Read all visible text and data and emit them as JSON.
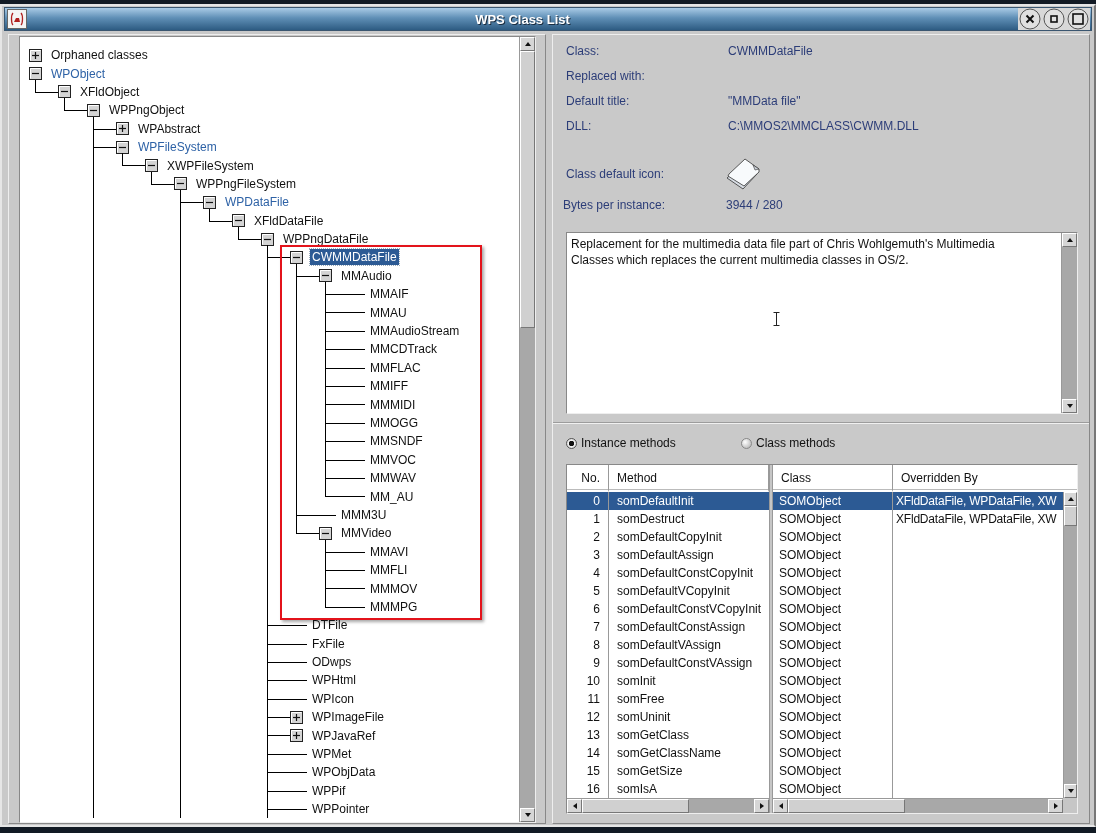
{
  "window": {
    "title": "WPS Class List"
  },
  "class_tree": [
    {
      "label": "Orphaned classes",
      "kind": "branch",
      "expanded": false,
      "replaced": false,
      "selected": false,
      "annotated": false
    },
    {
      "label": "WPObject",
      "kind": "branch",
      "expanded": true,
      "more_below": false,
      "replaced": true,
      "selected": false,
      "annotated": false,
      "children": [
        {
          "label": "XFldObject",
          "kind": "branch",
          "expanded": true,
          "more_below": false,
          "replaced": false,
          "selected": false,
          "annotated": false,
          "children": [
            {
              "label": "WPPngObject",
              "kind": "branch",
              "expanded": true,
              "more_below": true,
              "replaced": false,
              "selected": false,
              "annotated": false,
              "children": [
                {
                  "label": "WPAbstract",
                  "kind": "branch",
                  "expanded": false,
                  "replaced": false,
                  "selected": false,
                  "annotated": false
                },
                {
                  "label": "WPFileSystem",
                  "kind": "branch",
                  "expanded": true,
                  "more_below": false,
                  "replaced": true,
                  "selected": false,
                  "annotated": false,
                  "children": [
                    {
                      "label": "XWPFileSystem",
                      "kind": "branch",
                      "expanded": true,
                      "more_below": false,
                      "replaced": false,
                      "selected": false,
                      "annotated": false,
                      "children": [
                        {
                          "label": "WPPngFileSystem",
                          "kind": "branch",
                          "expanded": true,
                          "more_below": true,
                          "replaced": false,
                          "selected": false,
                          "annotated": false,
                          "children": [
                            {
                              "label": "WPDataFile",
                              "kind": "branch",
                              "expanded": true,
                              "more_below": false,
                              "replaced": true,
                              "selected": false,
                              "annotated": false,
                              "children": [
                                {
                                  "label": "XFldDataFile",
                                  "kind": "branch",
                                  "expanded": true,
                                  "more_below": false,
                                  "replaced": false,
                                  "selected": false,
                                  "annotated": false,
                                  "children": [
                                    {
                                      "label": "WPPngDataFile",
                                      "kind": "branch",
                                      "expanded": true,
                                      "more_below": true,
                                      "replaced": false,
                                      "selected": false,
                                      "annotated": false,
                                      "children": [
                                        {
                                          "label": "CWMMDataFile",
                                          "kind": "branch",
                                          "expanded": true,
                                          "more_below": false,
                                          "replaced": false,
                                          "selected": true,
                                          "annotated": true,
                                          "children": [
                                            {
                                              "label": "MMAudio",
                                              "kind": "branch",
                                              "expanded": true,
                                              "more_below": false,
                                              "replaced": false,
                                              "selected": false,
                                              "annotated": false,
                                              "children": [
                                                {
                                                  "label": "MMAIF",
                                                  "kind": "leaf",
                                                  "replaced": false,
                                                  "selected": false,
                                                  "annotated": false
                                                },
                                                {
                                                  "label": "MMAU",
                                                  "kind": "leaf",
                                                  "replaced": false,
                                                  "selected": false,
                                                  "annotated": false
                                                },
                                                {
                                                  "label": "MMAudioStream",
                                                  "kind": "leaf",
                                                  "replaced": false,
                                                  "selected": false,
                                                  "annotated": false
                                                },
                                                {
                                                  "label": "MMCDTrack",
                                                  "kind": "leaf",
                                                  "replaced": false,
                                                  "selected": false,
                                                  "annotated": false
                                                },
                                                {
                                                  "label": "MMFLAC",
                                                  "kind": "leaf",
                                                  "replaced": false,
                                                  "selected": false,
                                                  "annotated": false
                                                },
                                                {
                                                  "label": "MMIFF",
                                                  "kind": "leaf",
                                                  "replaced": false,
                                                  "selected": false,
                                                  "annotated": false
                                                },
                                                {
                                                  "label": "MMMIDI",
                                                  "kind": "leaf",
                                                  "replaced": false,
                                                  "selected": false,
                                                  "annotated": false
                                                },
                                                {
                                                  "label": "MMOGG",
                                                  "kind": "leaf",
                                                  "replaced": false,
                                                  "selected": false,
                                                  "annotated": false
                                                },
                                                {
                                                  "label": "MMSNDF",
                                                  "kind": "leaf",
                                                  "replaced": false,
                                                  "selected": false,
                                                  "annotated": false
                                                },
                                                {
                                                  "label": "MMVOC",
                                                  "kind": "leaf",
                                                  "replaced": false,
                                                  "selected": false,
                                                  "annotated": false
                                                },
                                                {
                                                  "label": "MMWAV",
                                                  "kind": "leaf",
                                                  "replaced": false,
                                                  "selected": false,
                                                  "annotated": false
                                                },
                                                {
                                                  "label": "MM_AU",
                                                  "kind": "leaf",
                                                  "replaced": false,
                                                  "selected": false,
                                                  "annotated": false
                                                }
                                              ]
                                            },
                                            {
                                              "label": "MMM3U",
                                              "kind": "leaf",
                                              "replaced": false,
                                              "selected": false,
                                              "annotated": false
                                            },
                                            {
                                              "label": "MMVideo",
                                              "kind": "branch",
                                              "expanded": true,
                                              "more_below": false,
                                              "replaced": false,
                                              "selected": false,
                                              "annotated": false,
                                              "children": [
                                                {
                                                  "label": "MMAVI",
                                                  "kind": "leaf",
                                                  "replaced": false,
                                                  "selected": false,
                                                  "annotated": false
                                                },
                                                {
                                                  "label": "MMFLI",
                                                  "kind": "leaf",
                                                  "replaced": false,
                                                  "selected": false,
                                                  "annotated": false
                                                },
                                                {
                                                  "label": "MMMOV",
                                                  "kind": "leaf",
                                                  "replaced": false,
                                                  "selected": false,
                                                  "annotated": false
                                                },
                                                {
                                                  "label": "MMMPG",
                                                  "kind": "leaf",
                                                  "replaced": false,
                                                  "selected": false,
                                                  "annotated": false
                                                }
                                              ]
                                            }
                                          ]
                                        },
                                        {
                                          "label": "DTFile",
                                          "kind": "leaf",
                                          "replaced": false,
                                          "selected": false,
                                          "annotated": false
                                        },
                                        {
                                          "label": "FxFile",
                                          "kind": "leaf",
                                          "replaced": false,
                                          "selected": false,
                                          "annotated": false
                                        },
                                        {
                                          "label": "ODwps",
                                          "kind": "leaf",
                                          "replaced": false,
                                          "selected": false,
                                          "annotated": false
                                        },
                                        {
                                          "label": "WPHtml",
                                          "kind": "leaf",
                                          "replaced": false,
                                          "selected": false,
                                          "annotated": false
                                        },
                                        {
                                          "label": "WPIcon",
                                          "kind": "leaf",
                                          "replaced": false,
                                          "selected": false,
                                          "annotated": false
                                        },
                                        {
                                          "label": "WPImageFile",
                                          "kind": "branch",
                                          "expanded": false,
                                          "replaced": false,
                                          "selected": false,
                                          "annotated": false
                                        },
                                        {
                                          "label": "WPJavaRef",
                                          "kind": "branch",
                                          "expanded": false,
                                          "replaced": false,
                                          "selected": false,
                                          "annotated": false
                                        },
                                        {
                                          "label": "WPMet",
                                          "kind": "leaf",
                                          "replaced": false,
                                          "selected": false,
                                          "annotated": false
                                        },
                                        {
                                          "label": "WPObjData",
                                          "kind": "leaf",
                                          "replaced": false,
                                          "selected": false,
                                          "annotated": false
                                        },
                                        {
                                          "label": "WPPif",
                                          "kind": "leaf",
                                          "replaced": false,
                                          "selected": false,
                                          "annotated": false
                                        },
                                        {
                                          "label": "WPPointer",
                                          "kind": "leaf",
                                          "replaced": false,
                                          "selected": false,
                                          "annotated": false
                                        }
                                      ]
                                    }
                                  ]
                                }
                              ]
                            }
                          ]
                        }
                      ]
                    }
                  ]
                }
              ]
            }
          ]
        }
      ]
    }
  ],
  "class_info": {
    "fields": [
      {
        "label": "Class:",
        "value": "CWMMDataFile"
      },
      {
        "label": "Replaced with:"
      },
      {
        "label": "Default title:",
        "value": "\"MMData file\""
      },
      {
        "label": "DLL:",
        "value": "C:\\MMOS2\\MMCLASS\\CWMM.DLL"
      }
    ],
    "icon_label": "Class default icon:",
    "bytes_label": "Bytes per instance:",
    "bytes_value": "3944 / 280"
  },
  "description": "Replacement for the multimedia data file part of Chris Wohlgemuth's Multimedia Classes which replaces the current multimedia classes in OS/2.",
  "method_filter": [
    {
      "label": "Instance methods",
      "selected": true
    },
    {
      "label": "Class methods",
      "selected": false
    }
  ],
  "methods_table": {
    "columns": [
      "No.",
      "Method",
      "Class",
      "Overridden By"
    ],
    "rows": [
      {
        "no": "0",
        "method": "somDefaultInit",
        "class": "SOMObject",
        "overridden_by": "XFldDataFile, WPDataFile, XW",
        "selected": true
      },
      {
        "no": "1",
        "method": "somDestruct",
        "class": "SOMObject",
        "overridden_by": "XFldDataFile, WPDataFile, XW",
        "selected": false
      },
      {
        "no": "2",
        "method": "somDefaultCopyInit",
        "class": "SOMObject",
        "selected": false
      },
      {
        "no": "3",
        "method": "somDefaultAssign",
        "class": "SOMObject",
        "selected": false
      },
      {
        "no": "4",
        "method": "somDefaultConstCopyInit",
        "class": "SOMObject",
        "selected": false
      },
      {
        "no": "5",
        "method": "somDefaultVCopyInit",
        "class": "SOMObject",
        "selected": false
      },
      {
        "no": "6",
        "method": "somDefaultConstVCopyInit",
        "class": "SOMObject",
        "selected": false
      },
      {
        "no": "7",
        "method": "somDefaultConstAssign",
        "class": "SOMObject",
        "selected": false
      },
      {
        "no": "8",
        "method": "somDefaultVAssign",
        "class": "SOMObject",
        "selected": false
      },
      {
        "no": "9",
        "method": "somDefaultConstVAssign",
        "class": "SOMObject",
        "selected": false
      },
      {
        "no": "10",
        "method": "somInit",
        "class": "SOMObject",
        "selected": false
      },
      {
        "no": "11",
        "method": "somFree",
        "class": "SOMObject",
        "selected": false
      },
      {
        "no": "12",
        "method": "somUninit",
        "class": "SOMObject",
        "selected": false
      },
      {
        "no": "13",
        "method": "somGetClass",
        "class": "SOMObject",
        "selected": false
      },
      {
        "no": "14",
        "method": "somGetClassName",
        "class": "SOMObject",
        "selected": false
      },
      {
        "no": "15",
        "method": "somGetSize",
        "class": "SOMObject",
        "selected": false
      },
      {
        "no": "16",
        "method": "somIsA",
        "class": "SOMObject",
        "selected": false
      }
    ]
  }
}
